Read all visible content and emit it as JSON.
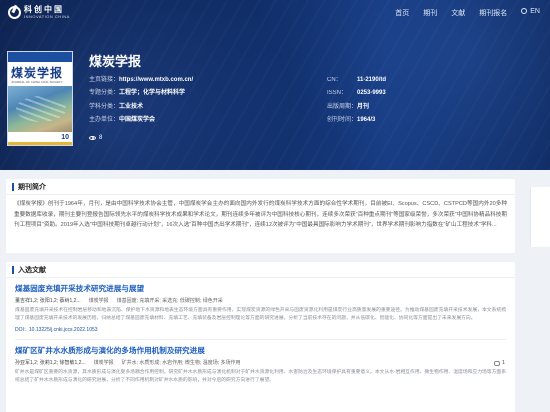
{
  "logo": {
    "cn": "科创中国",
    "en": "INNOVATION CHINA"
  },
  "nav": {
    "items": [
      "首页",
      "期刊",
      "文献",
      "期刊报名"
    ],
    "lang": "EN"
  },
  "cover": {
    "title": "煤炭学报",
    "subtitle": "JOURNAL OF CHINA COAL SOCIETY",
    "issue": "10"
  },
  "journal": {
    "title": "煤炭学报",
    "left": [
      {
        "k": "主页链接：",
        "v": "https://www.mtxb.com.cn/"
      },
      {
        "k": "专题分类：",
        "v": "工程学；化学与材料科学"
      },
      {
        "k": "学科分类：",
        "v": "工业技术"
      },
      {
        "k": "主办单位：",
        "v": "中国煤炭学会"
      }
    ],
    "right": [
      {
        "k": "CN：",
        "v": "11-2190/td"
      },
      {
        "k": "ISSN：",
        "v": "0253-9993"
      },
      {
        "k": "出版周期：",
        "v": "月刊"
      },
      {
        "k": "创刊时间：",
        "v": "1964/3"
      }
    ],
    "views": "8"
  },
  "intro": {
    "heading": "期刊简介",
    "text": "《煤炭学报》创刊于1964年，月刊，是由中国科学技术协会主管，中国煤炭学会主办的面向国内外发行的煤炭科学技术方面的综合性学术期刊，目前被EI、Scopus、CSCD、CSTPCD等国内外20多种重要数据库收录，期刊主要刊登报告国际领先水平的煤炭科学技术成果和学术论文，期刊连续多年被评为中国科技核心期刊，连续多次荣获“百种重点期刊”等国家级荣誉，多次荣获“中国科协精品科技期刊工程项目”资助。2019年入选“中国科技期刊卓越行动计划”，16次入选“百种中国杰出学术期刊”，连续12次被评为“中国最具国际影响力学术期刊”，世界学术期刊影响力指数在“矿山工程技术”学科..."
  },
  "articles": {
    "heading": "入选文献",
    "items": [
      {
        "title": "煤基固废充填开采技术研究进展与展望",
        "authors": "董吉祥1,2; 张阳1,2; 蔡树1,2...",
        "journal": "煤炭学报",
        "keywords": "煤基固废; 充填开采; 采选充; 低碳控制; 绿色开采",
        "abstract": "煤基固废充填开采技术在控制岩层移动和地表沉陷、保护地下水资源和地表生态环境方面具有重要作用，实现煤炭资源的绿色开采与固废资源化利用是煤炭行业高质量发展的重要途径。为推动煤基固废充填开采技术发展，本文系统梳理了煤基固废充填开采技术的发展历程，归纳总结了煤基固废充填材料、充填工艺、充填装备及岩层控制理论等方面的研究进展，分析了当前技术存在的问题，并从低碳化、智能化、协同化等方面提出了未来发展方向。",
        "doi": "DOI：10.13225/j.cnki.jccs.2022.1053",
        "comments": "1"
      },
      {
        "title": "煤矿区矿井水水质形成与演化的多场作用机制及研究进展",
        "authors": "孙亚军1,2; 张莉1,2; 徐智敏1,2...",
        "journal": "煤炭学报",
        "keywords": "矿井水; 水质形成; 水岩作用; 微生物; 温度场; 多场作用",
        "abstract": "矿井水是煤矿区重要的水资源，其水质形成与演化受多场耦合作用控制。研究矿井水水质形成与演化机制对于矿井水资源化利用、水害防治及生态环境保护具有重要意义。本文从水-岩相互作用、微生物作用、温度场和应力场等方面系统总结了矿井水水质形成与演化的研究进展，分析了不同作用机制对矿井水水质的影响，并对今后的研究方向进行了展望。"
      }
    ]
  }
}
